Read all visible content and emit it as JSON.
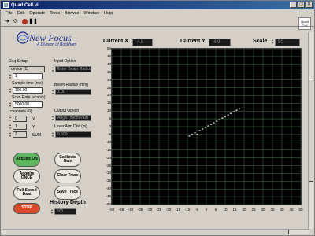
{
  "window": {
    "title": "Quad Cell.vi",
    "buttons": [
      "_",
      "□",
      "×"
    ]
  },
  "menu": [
    "File",
    "Edit",
    "Operate",
    "Tools",
    "Browse",
    "Window",
    "Help"
  ],
  "corner_tag": "Quad Cell",
  "logo": {
    "name": "New Focus",
    "subtitle": "A Division of Bookham"
  },
  "daq": {
    "title": "Daq Setup",
    "device_label": "device (1)",
    "device_value": "1",
    "sample_time_label": "Sample time (ms)",
    "sample_time_value": "100.00",
    "scan_rate_label": "Scan Rate (scan/s)",
    "scan_rate_value": "5000.00",
    "channels_label": "channels (0)",
    "channels": [
      {
        "value": "0",
        "name": "X"
      },
      {
        "value": "1",
        "name": "Y"
      },
      {
        "value": "2",
        "name": "SUM"
      }
    ]
  },
  "input_option": {
    "label": "Input Option",
    "value": "Enter Beam Radius"
  },
  "beam_radius": {
    "label": "Beam Radius (mm)",
    "value": "2.00"
  },
  "output_option": {
    "label": "Output Option",
    "value": "Angle (microRad)"
  },
  "lever_arm": {
    "label": "Lever Arm Dist (m)",
    "value": "0.500"
  },
  "buttons": {
    "acquire_on": "Acquire ON",
    "acquire_once": "Acquire ONCE",
    "full_speed": "Full Speed Data",
    "stop": "STOP",
    "calibrate": "Calibrate Gain",
    "clear": "Clear Trace",
    "save": "Save Trace"
  },
  "history": {
    "label": "History Depth",
    "value": "500"
  },
  "readouts": {
    "current_x_label": "Current X",
    "current_x_value": "-4.8",
    "current_y_label": "Current Y",
    "current_y_value": "-4.9",
    "scale_label": "Scale",
    "scale_value": "50"
  },
  "colors": {
    "plot_bg": "#000000",
    "grid": "#4a7a4a",
    "trace": "#ffffff"
  },
  "chart_data": {
    "type": "scatter",
    "title": "",
    "xlabel": "",
    "ylabel": "",
    "xlim": [
      -50,
      50
    ],
    "ylim": [
      -50,
      50
    ],
    "grid": true,
    "xticks": [
      -50,
      -45,
      -40,
      -35,
      -30,
      -25,
      -20,
      -15,
      -10,
      -5,
      0,
      5,
      10,
      15,
      20,
      25,
      30,
      35,
      40,
      45,
      50
    ],
    "yticks": [
      50,
      45,
      40,
      35,
      30,
      25,
      20,
      15,
      10,
      5,
      0,
      -5,
      -10,
      -15,
      -20,
      -25,
      -30,
      -35,
      -40,
      -45,
      -50
    ],
    "series": [
      {
        "points": [
          [
            -9,
            -6
          ],
          [
            -7.5,
            -5
          ],
          [
            -6,
            -4
          ],
          [
            -4.8,
            -4.9
          ],
          [
            -3.5,
            -2.5
          ],
          [
            -2,
            -1.5
          ],
          [
            -0.5,
            -0.5
          ],
          [
            1,
            0.5
          ],
          [
            2.5,
            1.5
          ],
          [
            4,
            2.5
          ],
          [
            5.5,
            3.5
          ],
          [
            7,
            4.5
          ],
          [
            8.5,
            5.5
          ],
          [
            10,
            6.5
          ],
          [
            11.5,
            7.5
          ],
          [
            13,
            8.5
          ],
          [
            14.5,
            9.5
          ],
          [
            16,
            10.5
          ],
          [
            17.5,
            11.5
          ]
        ]
      }
    ]
  }
}
